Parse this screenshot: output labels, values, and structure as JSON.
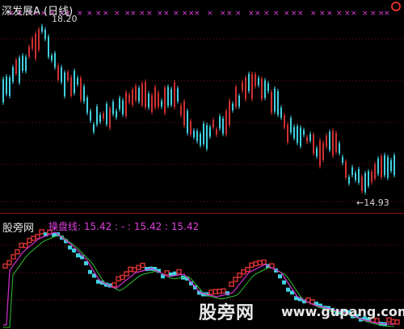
{
  "header": {
    "title": "深发展A (日线)"
  },
  "price_annotations": {
    "high": "18.20",
    "low": "←14.93"
  },
  "indicator": {
    "name": "股旁网",
    "formula": "操盘线: 15.42 : - : 15.42 : 15.42"
  },
  "watermark": {
    "brand": "股旁网",
    "site": "www.gupang.com"
  },
  "colors": {
    "background": "#000000",
    "up": "#d03030",
    "down": "#40d0e0",
    "signal": "#e040e0",
    "ma_green": "#30c030",
    "ma_magenta": "#d030d0",
    "divider": "#8a1010"
  },
  "icons": {
    "corner": "close-circle-icon"
  }
}
